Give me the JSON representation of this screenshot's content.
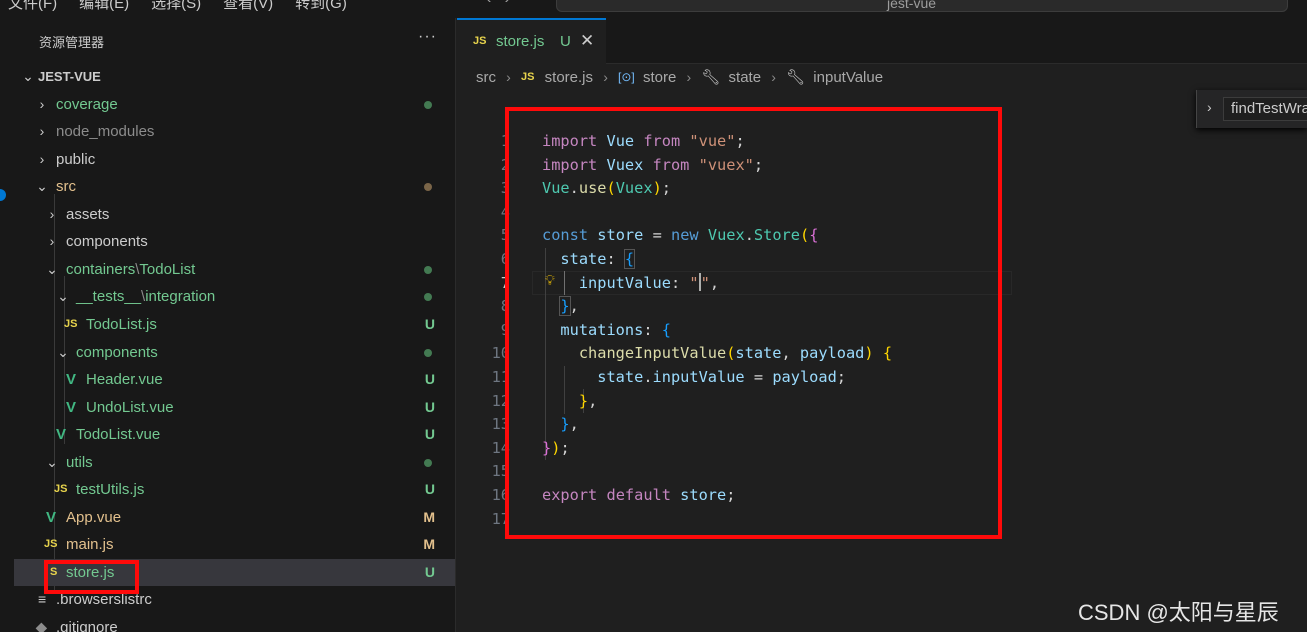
{
  "menu": {
    "items": [
      "文件(F)",
      "编辑(E)",
      "选择(S)",
      "查看(V)",
      "转到(G)"
    ]
  },
  "command_center": {
    "text": "jest-vue"
  },
  "explorer": {
    "header": "资源管理器",
    "more": "···",
    "root": "JEST-VUE",
    "items": [
      {
        "label": "coverage",
        "status": ""
      },
      {
        "label": "node_modules",
        "status": ""
      },
      {
        "label": "public",
        "status": ""
      },
      {
        "label": "src",
        "status": ""
      },
      {
        "label": "assets",
        "status": ""
      },
      {
        "label": "components",
        "status": ""
      },
      {
        "label_a": "containers",
        "sep": "\\",
        "label_b": "TodoList",
        "status": ""
      },
      {
        "label_a": "__tests__",
        "sep": "\\",
        "label_b": "integration",
        "status": ""
      },
      {
        "label": "TodoList.js",
        "status": "U"
      },
      {
        "label": "components",
        "status": ""
      },
      {
        "label": "Header.vue",
        "status": "U"
      },
      {
        "label": "UndoList.vue",
        "status": "U"
      },
      {
        "label": "TodoList.vue",
        "status": "U"
      },
      {
        "label": "utils",
        "status": ""
      },
      {
        "label": "testUtils.js",
        "status": "U"
      },
      {
        "label": "App.vue",
        "status": "M"
      },
      {
        "label": "main.js",
        "status": "M"
      },
      {
        "label": "store.js",
        "status": "U"
      },
      {
        "label": ".browserslistrc",
        "status": ""
      },
      {
        "label": ".gitignore",
        "status": ""
      }
    ]
  },
  "tab": {
    "icon": "JS",
    "name": "store.js",
    "status": "U",
    "close": "✕"
  },
  "breadcrumb": {
    "items": [
      "src",
      "store.js",
      "store",
      "state",
      "inputValue"
    ]
  },
  "sticky_scroll": {
    "text": "findTestWrapper"
  },
  "code": {
    "line_numbers": [
      "1",
      "2",
      "3",
      "4",
      "5",
      "6",
      "7",
      "8",
      "9",
      "10",
      "11",
      "12",
      "13",
      "14",
      "15",
      "16",
      "17"
    ],
    "active_line": "7"
  },
  "watermark": "CSDN @太阳与星辰",
  "colors": {
    "annotation": "#ff0a0a",
    "accent": "#0078d4",
    "untracked": "#73c991",
    "modified": "#e2c08d"
  },
  "icons": [
    "js-file-icon",
    "vue-file-icon",
    "chevron-right-icon",
    "chevron-down-icon",
    "lightbulb-icon",
    "close-icon",
    "symbol-icon",
    "wrench-icon"
  ]
}
